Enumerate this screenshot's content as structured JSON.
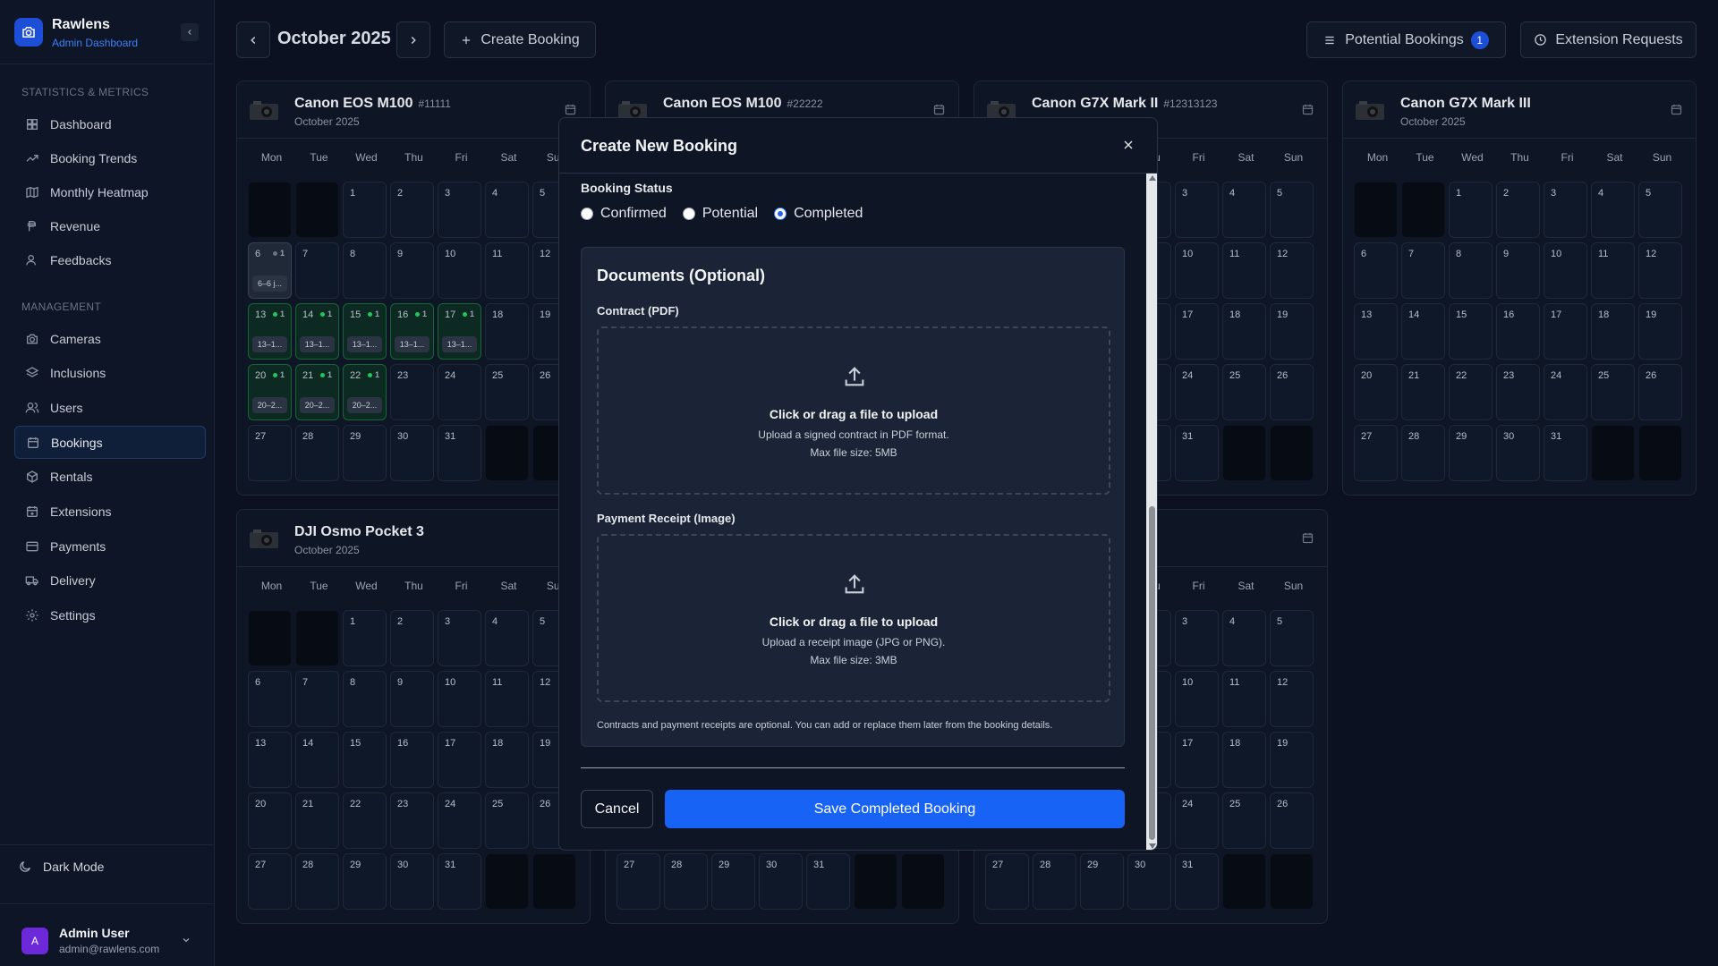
{
  "sidebar": {
    "brand_name": "Rawlens",
    "brand_sub": "Admin Dashboard",
    "section_stats": "STATISTICS & METRICS",
    "section_mgmt": "MANAGEMENT",
    "stats_items": [
      {
        "label": "Dashboard",
        "icon": "dashboard-icon"
      },
      {
        "label": "Booking Trends",
        "icon": "trend-icon"
      },
      {
        "label": "Monthly Heatmap",
        "icon": "map-icon"
      },
      {
        "label": "Revenue",
        "icon": "peso-icon"
      },
      {
        "label": "Feedbacks",
        "icon": "user-feedback-icon"
      }
    ],
    "mgmt_items": [
      {
        "label": "Cameras",
        "icon": "camera-icon"
      },
      {
        "label": "Inclusions",
        "icon": "layers-icon"
      },
      {
        "label": "Users",
        "icon": "users-icon"
      },
      {
        "label": "Bookings",
        "icon": "calendar-icon",
        "active": true
      },
      {
        "label": "Rentals",
        "icon": "package-icon"
      },
      {
        "label": "Extensions",
        "icon": "calendar-plus-icon"
      },
      {
        "label": "Payments",
        "icon": "credit-card-icon"
      },
      {
        "label": "Delivery",
        "icon": "truck-icon"
      },
      {
        "label": "Settings",
        "icon": "gear-icon"
      }
    ],
    "dark_mode": "Dark Mode",
    "user": {
      "initial": "A",
      "name": "Admin User",
      "email": "admin@rawlens.com"
    }
  },
  "topbar": {
    "month": "October 2025",
    "create_booking": "Create Booking",
    "potential_bookings": "Potential Bookings",
    "potential_count": "1",
    "extension_requests": "Extension Requests"
  },
  "dows": [
    "Mon",
    "Tue",
    "Wed",
    "Thu",
    "Fri",
    "Sat",
    "Sun"
  ],
  "cards": [
    {
      "title": "Canon EOS M100",
      "id": "#11111",
      "sub": "October 2025"
    },
    {
      "title": "Canon EOS M100",
      "id": "#22222",
      "sub": ""
    },
    {
      "title": "Canon G7X Mark II",
      "id": "#12313123",
      "sub": ""
    },
    {
      "title": "Canon G7X Mark III",
      "id": "",
      "sub": "October 2025"
    },
    {
      "title": "DJI Osmo Pocket 3",
      "id": "",
      "sub": "October 2025"
    }
  ],
  "booking_chips": {
    "d6": "6–6 j...",
    "week13": "13–1...",
    "week20": "20–2...",
    "count": "1"
  },
  "modal": {
    "title": "Create New Booking",
    "status_label": "Booking Status",
    "options": [
      "Confirmed",
      "Potential",
      "Completed"
    ],
    "selected": "Completed",
    "docs_title": "Documents (Optional)",
    "contract_label": "Contract (PDF)",
    "contract_main": "Click or drag a file to upload",
    "contract_sub": "Upload a signed contract in PDF format.",
    "contract_max": "Max file size: 5MB",
    "receipt_label": "Payment Receipt (Image)",
    "receipt_main": "Click or drag a file to upload",
    "receipt_sub": "Upload a receipt image (JPG or PNG).",
    "receipt_max": "Max file size: 3MB",
    "note": "Contracts and payment receipts are optional. You can add or replace them later from the booking details.",
    "cancel": "Cancel",
    "save": "Save Completed Booking"
  },
  "colors": {
    "accent": "#1763f5",
    "booked": "#0d2a22",
    "background": "#0b1120"
  }
}
